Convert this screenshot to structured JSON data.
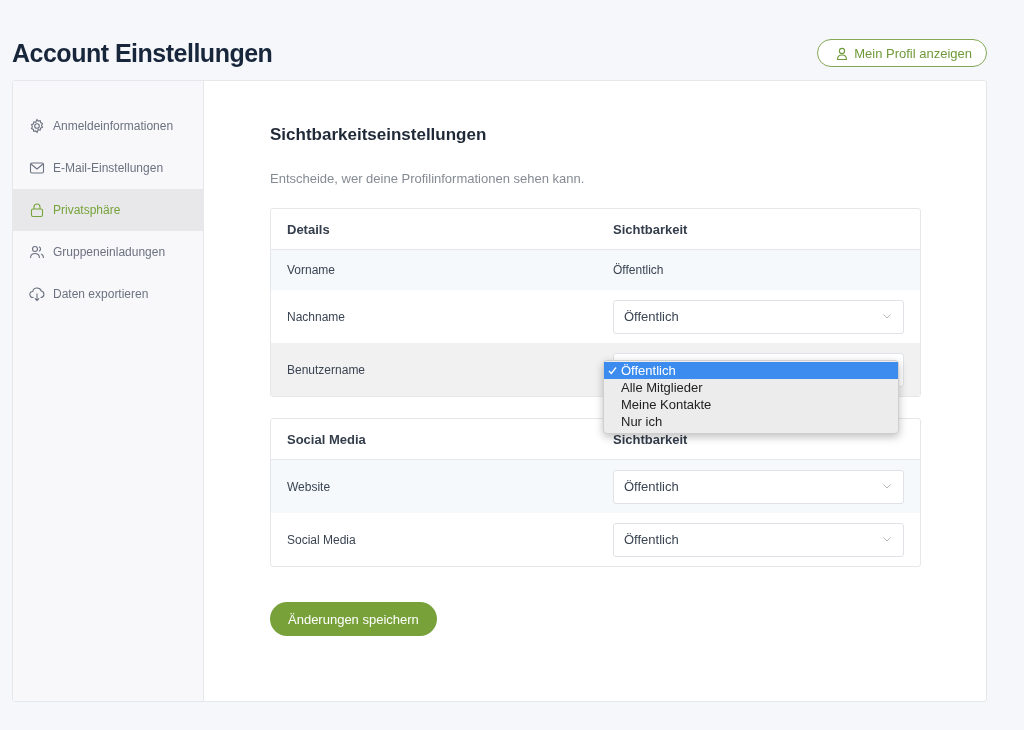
{
  "page_title": "Account Einstellungen",
  "profile_button": "Mein Profil anzeigen",
  "sidebar": {
    "items": [
      {
        "label": "Anmeldeinformationen",
        "kind": "gear",
        "selected": false
      },
      {
        "label": "E-Mail-Einstellungen",
        "kind": "mail",
        "selected": false
      },
      {
        "label": "Privatsphäre",
        "kind": "lock",
        "selected": true
      },
      {
        "label": "Gruppeneinladungen",
        "kind": "users",
        "selected": false
      },
      {
        "label": "Daten exportieren",
        "kind": "download",
        "selected": false
      }
    ]
  },
  "section": {
    "title": "Sichtbarkeitseinstellungen",
    "description": "Entscheide, wer deine Profilinformationen sehen kann."
  },
  "tables": [
    {
      "columns": [
        "Details",
        "Sichtbarkeit"
      ],
      "rows": [
        {
          "label": "Vorname",
          "kind": "text",
          "value": "Öffentlich"
        },
        {
          "label": "Nachname",
          "kind": "select",
          "value": "Öffentlich",
          "open": false
        },
        {
          "label": "Benutzername",
          "kind": "select",
          "open": true,
          "options": [
            {
              "label": "Öffentlich",
              "selected": true
            },
            {
              "label": "Alle Mitglieder",
              "selected": false
            },
            {
              "label": "Meine Kontakte",
              "selected": false
            },
            {
              "label": "Nur ich",
              "selected": false
            }
          ]
        }
      ]
    },
    {
      "columns": [
        "Social Media",
        "Sichtbarkeit"
      ],
      "rows": [
        {
          "label": "Website",
          "kind": "select",
          "value": "Öffentlich",
          "open": false
        },
        {
          "label": "Social Media",
          "kind": "select",
          "value": "Öffentlich",
          "open": false
        }
      ]
    }
  ],
  "save_button": "Änderungen speichern"
}
